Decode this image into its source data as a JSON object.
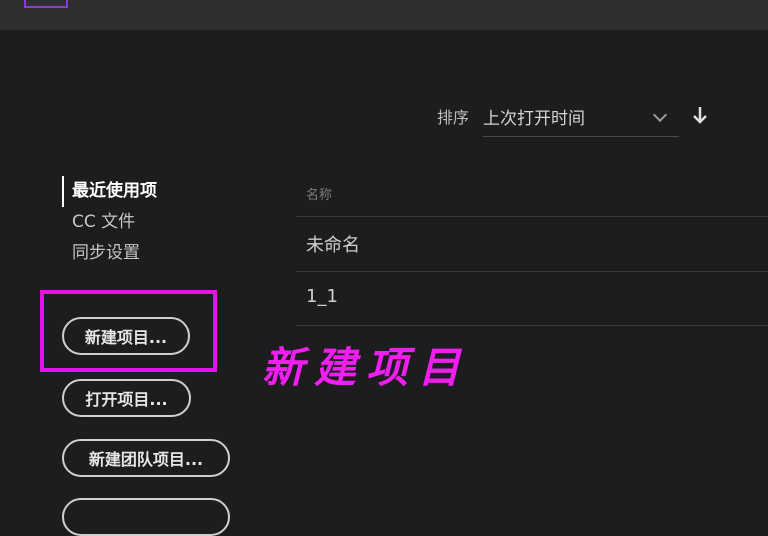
{
  "sort": {
    "label": "排序",
    "value": "上次打开时间"
  },
  "nav": {
    "items": [
      "最近使用项",
      "CC 文件",
      "同步设置"
    ]
  },
  "buttons": {
    "new_project": "新建项目...",
    "open_project": "打开项目...",
    "new_team_project": "新建团队项目..."
  },
  "annotation": {
    "text": "新建项目"
  },
  "list": {
    "column_name": "名称",
    "rows": [
      "未命名",
      "1_1"
    ]
  },
  "colors": {
    "highlight": "#ea12e3",
    "background": "#1d1c1e"
  }
}
